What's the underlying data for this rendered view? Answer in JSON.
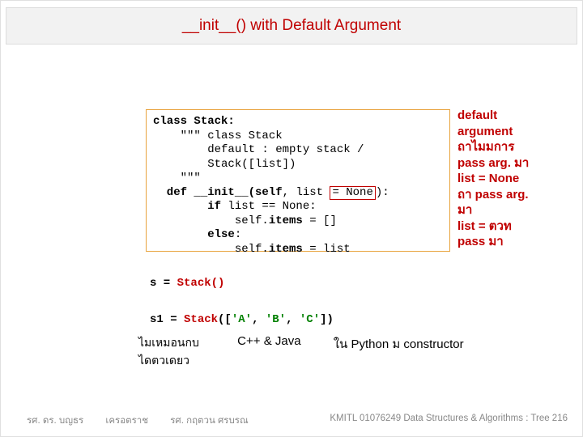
{
  "title": "__init__()  with  Default Argument",
  "code": {
    "l1a": "class",
    "l1b": " Stack:",
    "l2": "    \"\"\" class Stack",
    "l3": "        default : empty stack /",
    "l4": "        Stack([list])",
    "l5": "    \"\"\"",
    "l6a": "  def",
    "l6b": " __init__(",
    "l6c": "self",
    "l6d": ", list ",
    "l6e": "= None",
    "l6f": "):",
    "l7a": "        if",
    "l7b": " list == None:",
    "l8a": "            self.",
    "l8b": "items",
    "l8c": " = []",
    "l9a": "        else",
    "l9b": ":",
    "l10a": "            self.",
    "l10b": "items",
    "l10c": " = list"
  },
  "annotation": "default\nargument\nถาไมมการ\npass arg. มา\nlist = None\nถา   pass arg.\nมา\nlist = ตวท\npass มา",
  "usage": {
    "l1a": "s = ",
    "l1b": "Stack()",
    "l2a": "s1 = ",
    "l2b": "Stack",
    "l2c": "([",
    "l2d": "'A'",
    "l2e": ", ",
    "l2f": "'B'",
    "l2g": ", ",
    "l2h": "'C'",
    "l2i": "])"
  },
  "note": {
    "left1": "ไมเหมอนกบ",
    "left2": "ไดตวเดยว",
    "mid": "C++ & Java",
    "right": "ใน Python ม   constructor"
  },
  "footer": {
    "a": "รศ. ดร. บญธร",
    "b": "เครอตราช",
    "c": "รศ. กฤตวน  ศรบรณ",
    "d": "KMITL   01076249 Data Structures & Algorithms : Tree 216"
  }
}
